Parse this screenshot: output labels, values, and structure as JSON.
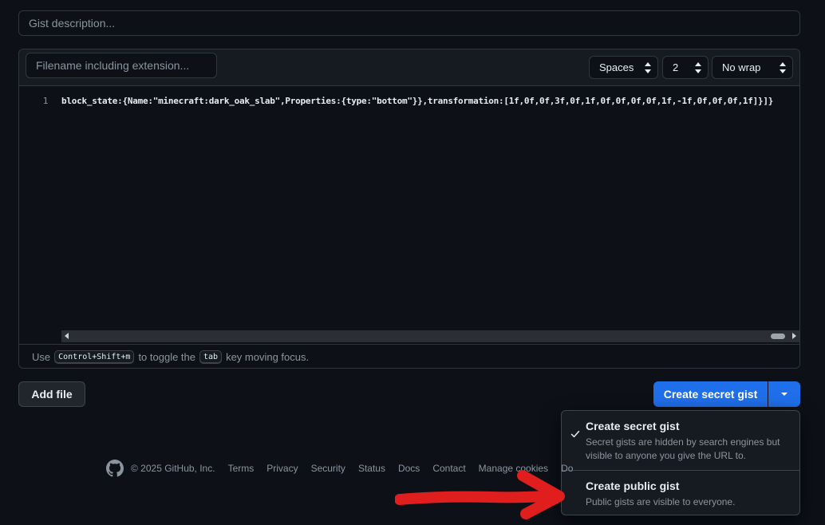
{
  "gist": {
    "description_placeholder": "Gist description...",
    "filename_placeholder": "Filename including extension...",
    "indent_mode": "Spaces",
    "indent_size": "2",
    "wrap_mode": "No wrap",
    "line_number": "1",
    "code_line": "block_state:{Name:\"minecraft:dark_oak_slab\",Properties:{type:\"bottom\"}},transformation:[1f,0f,0f,3f,0f,1f,0f,0f,0f,0f,1f,-1f,0f,0f,0f,1f]}]}"
  },
  "hint": {
    "prefix": "Use",
    "shortcut": "Control+Shift+m",
    "middle": "to toggle the",
    "key": "tab",
    "suffix": "key moving focus."
  },
  "actions": {
    "add_file": "Add file",
    "create_secret": "Create secret gist"
  },
  "menu": {
    "items": [
      {
        "title": "Create secret gist",
        "desc": "Secret gists are hidden by search engines but visible to anyone you give the URL to.",
        "selected": true
      },
      {
        "title": "Create public gist",
        "desc": "Public gists are visible to everyone.",
        "selected": false
      }
    ]
  },
  "footer": {
    "copyright": "© 2025 GitHub, Inc.",
    "links": [
      "Terms",
      "Privacy",
      "Security",
      "Status",
      "Docs",
      "Contact",
      "Manage cookies",
      "Do"
    ]
  },
  "colors": {
    "background": "#0d1117",
    "primary_button": "#1f6feb",
    "annotation_arrow": "#e01e1e"
  },
  "icons": {
    "logo": "github-mark-icon",
    "check": "check-icon",
    "caret": "triangle-down-icon",
    "annotation": "red-arrow-annotation"
  }
}
